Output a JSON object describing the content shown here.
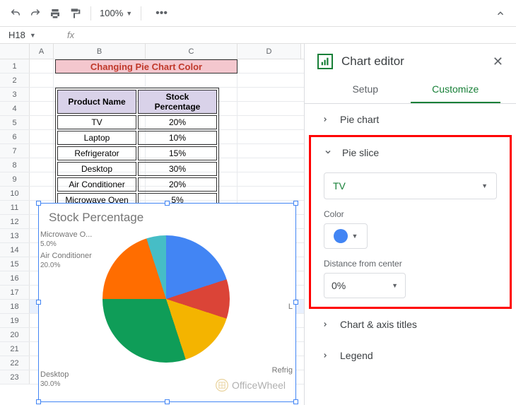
{
  "toolbar": {
    "zoom": "100%"
  },
  "namebox": "H18",
  "fx": "fx",
  "columns": [
    "A",
    "B",
    "C",
    "D"
  ],
  "rows": [
    1,
    2,
    3,
    4,
    5,
    6,
    7,
    8,
    9,
    10,
    11,
    12,
    13,
    14,
    15,
    16,
    17,
    18,
    19,
    20,
    21,
    22,
    23
  ],
  "active_row": 18,
  "title_banner": "Changing Pie Chart Color",
  "table": {
    "headers": [
      "Product Name",
      "Stock Percentage"
    ],
    "rows": [
      [
        "TV",
        "20%"
      ],
      [
        "Laptop",
        "10%"
      ],
      [
        "Refrigerator",
        "15%"
      ],
      [
        "Desktop",
        "30%"
      ],
      [
        "Air Conditioner",
        "20%"
      ],
      [
        "Microwave Oven",
        "5%"
      ]
    ]
  },
  "chart_data": {
    "type": "pie",
    "title": "Stock Percentage",
    "series": [
      {
        "name": "TV",
        "value": 20,
        "label_pct": "20.0%",
        "color": "#4285f4"
      },
      {
        "name": "Laptop",
        "value": 10,
        "label_pct": "10.0%",
        "color": "#db4437"
      },
      {
        "name": "Refrigerator",
        "value": 15,
        "label_pct": "15.0%",
        "color": "#f4b400"
      },
      {
        "name": "Desktop",
        "value": 30,
        "label_pct": "30.0%",
        "color": "#0f9d58"
      },
      {
        "name": "Air Conditioner",
        "value": 20,
        "label_pct": "20.0%",
        "color": "#ff6d00"
      },
      {
        "name": "Microwave Oven",
        "value": 5,
        "label_pct": "5.0%",
        "color": "#46bdc6"
      }
    ],
    "visible_labels": [
      {
        "name": "Microwave O...",
        "pct": "5.0%"
      },
      {
        "name": "Air Conditioner",
        "pct": "20.0%"
      },
      {
        "name": "Desktop",
        "pct": "30.0%"
      },
      {
        "name": "Refrig",
        "pct": ""
      },
      {
        "name": "L",
        "pct": ""
      }
    ]
  },
  "editor": {
    "title": "Chart editor",
    "tabs": {
      "setup": "Setup",
      "customize": "Customize"
    },
    "sections": {
      "pie_chart": "Pie chart",
      "pie_slice": "Pie slice",
      "chart_axis": "Chart & axis titles",
      "legend": "Legend"
    },
    "slice_select": "TV",
    "color_label": "Color",
    "color_value": "#4285f4",
    "distance_label": "Distance from center",
    "distance_value": "0%"
  },
  "watermark": "OfficeWheel"
}
